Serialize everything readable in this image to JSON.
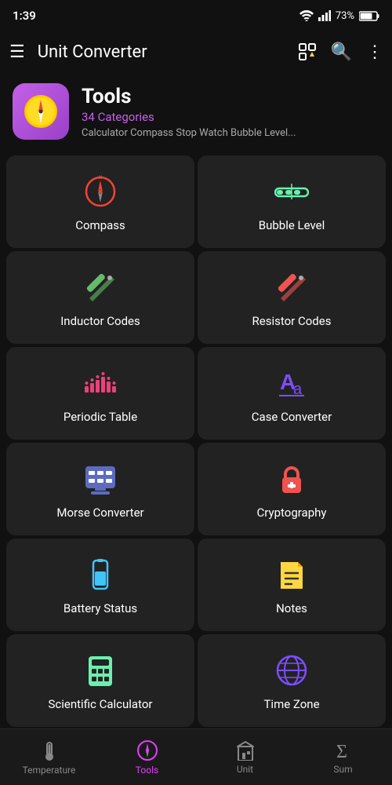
{
  "statusBar": {
    "time": "1:39",
    "battery": "73%"
  },
  "topBar": {
    "title": "Unit Converter",
    "menuIcon": "menu-icon",
    "favGridIcon": "fav-grid-icon",
    "searchIcon": "search-icon",
    "moreIcon": "more-icon"
  },
  "categoryHeader": {
    "name": "Tools",
    "count": "34 Categories",
    "description": "Calculator Compass Stop Watch Bubble Level..."
  },
  "gridItems": [
    {
      "id": "compass",
      "label": "Compass",
      "iconColor": "#f44336",
      "iconType": "compass"
    },
    {
      "id": "bubble-level",
      "label": "Bubble Level",
      "iconColor": "#69f0ae",
      "iconType": "bubble-level"
    },
    {
      "id": "inductor-codes",
      "label": "Inductor Codes",
      "iconColor": "#66bb6a",
      "iconType": "inductor"
    },
    {
      "id": "resistor-codes",
      "label": "Resistor Codes",
      "iconColor": "#ef5350",
      "iconType": "resistor"
    },
    {
      "id": "periodic-table",
      "label": "Periodic Table",
      "iconColor": "#ec407a",
      "iconType": "periodic"
    },
    {
      "id": "case-converter",
      "label": "Case Converter",
      "iconColor": "#7c4dff",
      "iconType": "case"
    },
    {
      "id": "morse-converter",
      "label": "Morse Converter",
      "iconColor": "#5c6bc0",
      "iconType": "morse"
    },
    {
      "id": "cryptography",
      "label": "Cryptography",
      "iconColor": "#ef5350",
      "iconType": "crypto"
    },
    {
      "id": "battery-status",
      "label": "Battery Status",
      "iconColor": "#40c4ff",
      "iconType": "battery"
    },
    {
      "id": "notes",
      "label": "Notes",
      "iconColor": "#ffd740",
      "iconType": "notes"
    },
    {
      "id": "scientific-calculator",
      "label": "Scientific Calculator",
      "iconColor": "#69f0ae",
      "iconType": "calc"
    },
    {
      "id": "time-zone",
      "label": "Time Zone",
      "iconColor": "#7c4dff",
      "iconType": "globe"
    }
  ],
  "bottomNav": [
    {
      "id": "temperature",
      "label": "Temperature",
      "active": false,
      "icon": "thermometer-icon"
    },
    {
      "id": "tools",
      "label": "Tools",
      "active": true,
      "icon": "compass-nav-icon"
    },
    {
      "id": "unit",
      "label": "Unit",
      "active": false,
      "icon": "building-icon"
    },
    {
      "id": "sum",
      "label": "Sum",
      "active": false,
      "icon": "sigma-icon"
    }
  ]
}
